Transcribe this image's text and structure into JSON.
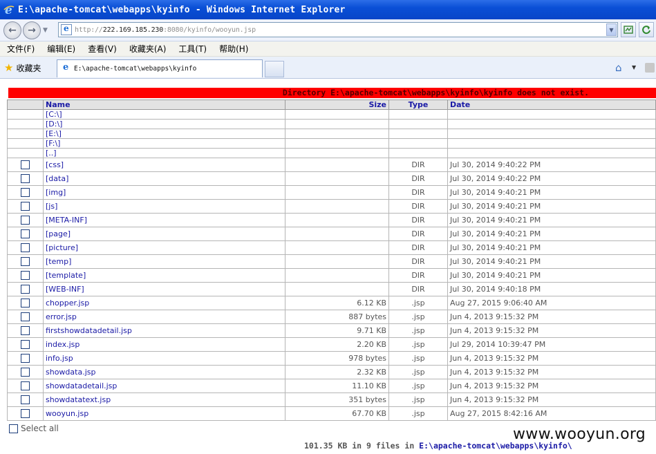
{
  "window": {
    "title": "E:\\apache-tomcat\\webapps\\kyinfo - Windows Internet Explorer"
  },
  "nav": {
    "url_scheme": "http://",
    "url_host": "222.169.185.230",
    "url_rest": ":8080/kyinfo/wooyun.jsp"
  },
  "menu": {
    "items": [
      "文件(F)",
      "编辑(E)",
      "查看(V)",
      "收藏夹(A)",
      "工具(T)",
      "帮助(H)"
    ]
  },
  "tabs": {
    "favorites_label": "收藏夹",
    "active_tab_title": "E:\\apache-tomcat\\webapps\\kyinfo"
  },
  "page": {
    "error_message": "Directory E:\\apache-tomcat\\webapps\\kyinfo\\kyinfo does not exist.",
    "headers": {
      "name": "Name",
      "size": "Size",
      "type": "Type",
      "date": "Date"
    },
    "drives": [
      "[C:\\]",
      "[D:\\]",
      "[E:\\]",
      "[F:\\]",
      "[..]"
    ],
    "entries": [
      {
        "name": "[css]",
        "size": "",
        "type": "DIR",
        "date": "Jul 30, 2014 9:40:22 PM"
      },
      {
        "name": "[data]",
        "size": "",
        "type": "DIR",
        "date": "Jul 30, 2014 9:40:22 PM"
      },
      {
        "name": "[img]",
        "size": "",
        "type": "DIR",
        "date": "Jul 30, 2014 9:40:21 PM"
      },
      {
        "name": "[js]",
        "size": "",
        "type": "DIR",
        "date": "Jul 30, 2014 9:40:21 PM"
      },
      {
        "name": "[META-INF]",
        "size": "",
        "type": "DIR",
        "date": "Jul 30, 2014 9:40:21 PM"
      },
      {
        "name": "[page]",
        "size": "",
        "type": "DIR",
        "date": "Jul 30, 2014 9:40:21 PM"
      },
      {
        "name": "[picture]",
        "size": "",
        "type": "DIR",
        "date": "Jul 30, 2014 9:40:21 PM"
      },
      {
        "name": "[temp]",
        "size": "",
        "type": "DIR",
        "date": "Jul 30, 2014 9:40:21 PM"
      },
      {
        "name": "[template]",
        "size": "",
        "type": "DIR",
        "date": "Jul 30, 2014 9:40:21 PM"
      },
      {
        "name": "[WEB-INF]",
        "size": "",
        "type": "DIR",
        "date": "Jul 30, 2014 9:40:18 PM"
      },
      {
        "name": "chopper.jsp",
        "size": "6.12 KB",
        "type": ".jsp",
        "date": "Aug 27, 2015 9:06:40 AM"
      },
      {
        "name": "error.jsp",
        "size": "887 bytes",
        "type": ".jsp",
        "date": "Jun 4, 2013 9:15:32 PM"
      },
      {
        "name": "firstshowdatadetail.jsp",
        "size": "9.71 KB",
        "type": ".jsp",
        "date": "Jun 4, 2013 9:15:32 PM"
      },
      {
        "name": "index.jsp",
        "size": "2.20 KB",
        "type": ".jsp",
        "date": "Jul 29, 2014 10:39:47 PM"
      },
      {
        "name": "info.jsp",
        "size": "978 bytes",
        "type": ".jsp",
        "date": "Jun 4, 2013 9:15:32 PM"
      },
      {
        "name": "showdata.jsp",
        "size": "2.32 KB",
        "type": ".jsp",
        "date": "Jun 4, 2013 9:15:32 PM"
      },
      {
        "name": "showdatadetail.jsp",
        "size": "11.10 KB",
        "type": ".jsp",
        "date": "Jun 4, 2013 9:15:32 PM"
      },
      {
        "name": "showdatatext.jsp",
        "size": "351 bytes",
        "type": ".jsp",
        "date": "Jun 4, 2013 9:15:32 PM"
      },
      {
        "name": "wooyun.jsp",
        "size": "67.70 KB",
        "type": ".jsp",
        "date": "Aug 27, 2015 8:42:16 AM"
      }
    ],
    "select_all_label": "Select all",
    "summary_text": "101.35 KB in 9 files in ",
    "summary_path": "E:\\apache-tomcat\\webapps\\kyinfo\\"
  },
  "watermark": "www.wooyun.org"
}
